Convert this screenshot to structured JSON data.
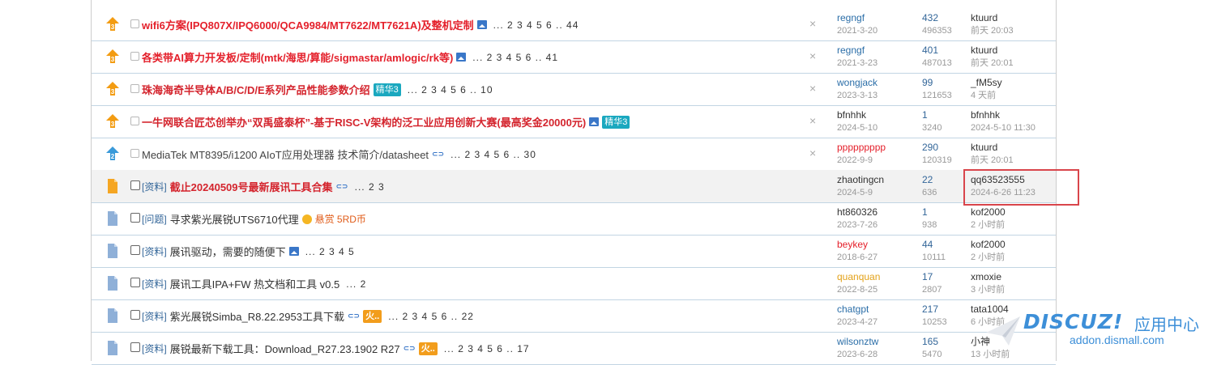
{
  "colors": {
    "accent": "#369",
    "title_red": "#e4202b",
    "badge": "#1aa8bf",
    "highlight_box": "#d9454b"
  },
  "rows": [
    {
      "icon": "pin-3-icon",
      "title": "wifi6方案(IPQ807X/IPQ6000/QCA9984/MT7622/MT7621A)及整机定制",
      "style": "red",
      "has_image": true,
      "pages": "... 2  3  4  5  6 .. 44",
      "author": "regngf",
      "author_color": "#2b6ea8",
      "post_date": "2021-3-20",
      "replies": "432",
      "views": "496353",
      "last_user": "ktuurd",
      "last_time": "前天 20:03"
    },
    {
      "icon": "pin-3-icon",
      "title": "各类带AI算力开发板/定制(mtk/海思/算能/sigmastar/amlogic/rk等)",
      "style": "red",
      "has_image": true,
      "pages": "... 2  3  4  5  6 .. 41",
      "author": "regngf",
      "author_color": "#2b6ea8",
      "post_date": "2021-3-23",
      "replies": "401",
      "views": "487013",
      "last_user": "ktuurd",
      "last_time": "前天 20:01"
    },
    {
      "icon": "pin-3-icon",
      "title": "珠海海奇半导体A/B/C/D/E系列产品性能参数介绍",
      "style": "red2",
      "badge": "精华3",
      "pages": "... 2  3  4  5  6 .. 10",
      "author": "wongjack",
      "author_color": "#2b6ea8",
      "post_date": "2023-3-13",
      "replies": "99",
      "views": "121653",
      "last_user": "_fM5sy",
      "last_time": "4 天前"
    },
    {
      "icon": "pin-3-icon",
      "title": "一牛网联合匠芯创举办“双禹盛泰杯”-基于RISC-V架构的泛工业应用创新大赛(最高奖金20000元)",
      "style": "red2",
      "has_image": true,
      "badge": "精华3",
      "author": "bfnhhk",
      "author_color": "#333",
      "post_date": "2024-5-10",
      "replies": "1",
      "views": "3240",
      "last_user": "bfnhhk",
      "last_time": "2024-5-10 11:30"
    },
    {
      "icon": "pin-2-icon",
      "title": "MediaTek MT8395/i1200 AIoT应用处理器 技术简介/datasheet",
      "style": "gray",
      "has_link": true,
      "pages": "... 2  3  4  5  6 .. 30",
      "author": "ppppppppp",
      "author_color": "#e4202b",
      "post_date": "2022-9-9",
      "replies": "290",
      "views": "120319",
      "last_user": "ktuurd",
      "last_time": "前天 20:01"
    },
    {
      "icon": "new-thread-icon",
      "type": "[资料]",
      "title": "截止20240509号最新展讯工具合集",
      "style": "red2",
      "has_link": true,
      "pages": "... 2  3",
      "author": "zhaotingcn",
      "author_color": "#333",
      "post_date": "2024-5-9",
      "replies": "22",
      "views": "636",
      "last_user": "qq63523555",
      "last_time": "2024-6-26 11:23"
    },
    {
      "icon": "thread-icon",
      "type": "[问题]",
      "title": "寻求紫光展锐UTS6710代理",
      "style": "normal",
      "reward": "悬赏 5RD币",
      "author": "ht860326",
      "author_color": "#333",
      "post_date": "2023-7-26",
      "replies": "1",
      "views": "938",
      "last_user": "kof2000",
      "last_time": "2 小时前"
    },
    {
      "icon": "thread-icon",
      "type": "[资料]",
      "title": "展讯驱动，需要的随便下",
      "style": "normal",
      "has_image": true,
      "pages": "... 2  3  4  5",
      "author": "beykey",
      "author_color": "#e4202b",
      "post_date": "2018-6-27",
      "replies": "44",
      "views": "10111",
      "last_user": "kof2000",
      "last_time": "2 小时前"
    },
    {
      "icon": "thread-icon",
      "type": "[资料]",
      "title": "展讯工具IPA+FW 热文档和工具 v0.5",
      "style": "normal",
      "pages": "... 2",
      "author": "quanquan",
      "author_color": "#e3a21a",
      "post_date": "2022-8-25",
      "replies": "17",
      "views": "2807",
      "last_user": "xmoxie",
      "last_time": "3 小时前"
    },
    {
      "icon": "thread-icon",
      "type": "[资料]",
      "title": "紫光展锐Simba_R8.22.2953工具下载",
      "style": "normal",
      "has_link": true,
      "hot": "火..",
      "pages": "... 2  3  4  5  6 .. 22",
      "author": "chatgpt",
      "author_color": "#2b6ea8",
      "post_date": "2023-4-27",
      "replies": "217",
      "views": "10253",
      "last_user": "tata1004",
      "last_time": "6 小时前"
    },
    {
      "icon": "thread-icon",
      "type": "[资料]",
      "title": "展锐最新下载工具：Download_R27.23.1902 R27",
      "style": "normal",
      "has_link": true,
      "hot": "火..",
      "pages": "... 2  3  4  5  6 .. 17",
      "author": "wilsonztw",
      "author_color": "#2b6ea8",
      "post_date": "2023-6-28",
      "replies": "165",
      "views": "5470",
      "last_user": "小神",
      "last_time": "13 小时前"
    }
  ],
  "close_glyph": "×",
  "watermark": {
    "logo": "DISCUZ!",
    "cn": "应用中心",
    "url": "addon.dismall.com"
  }
}
